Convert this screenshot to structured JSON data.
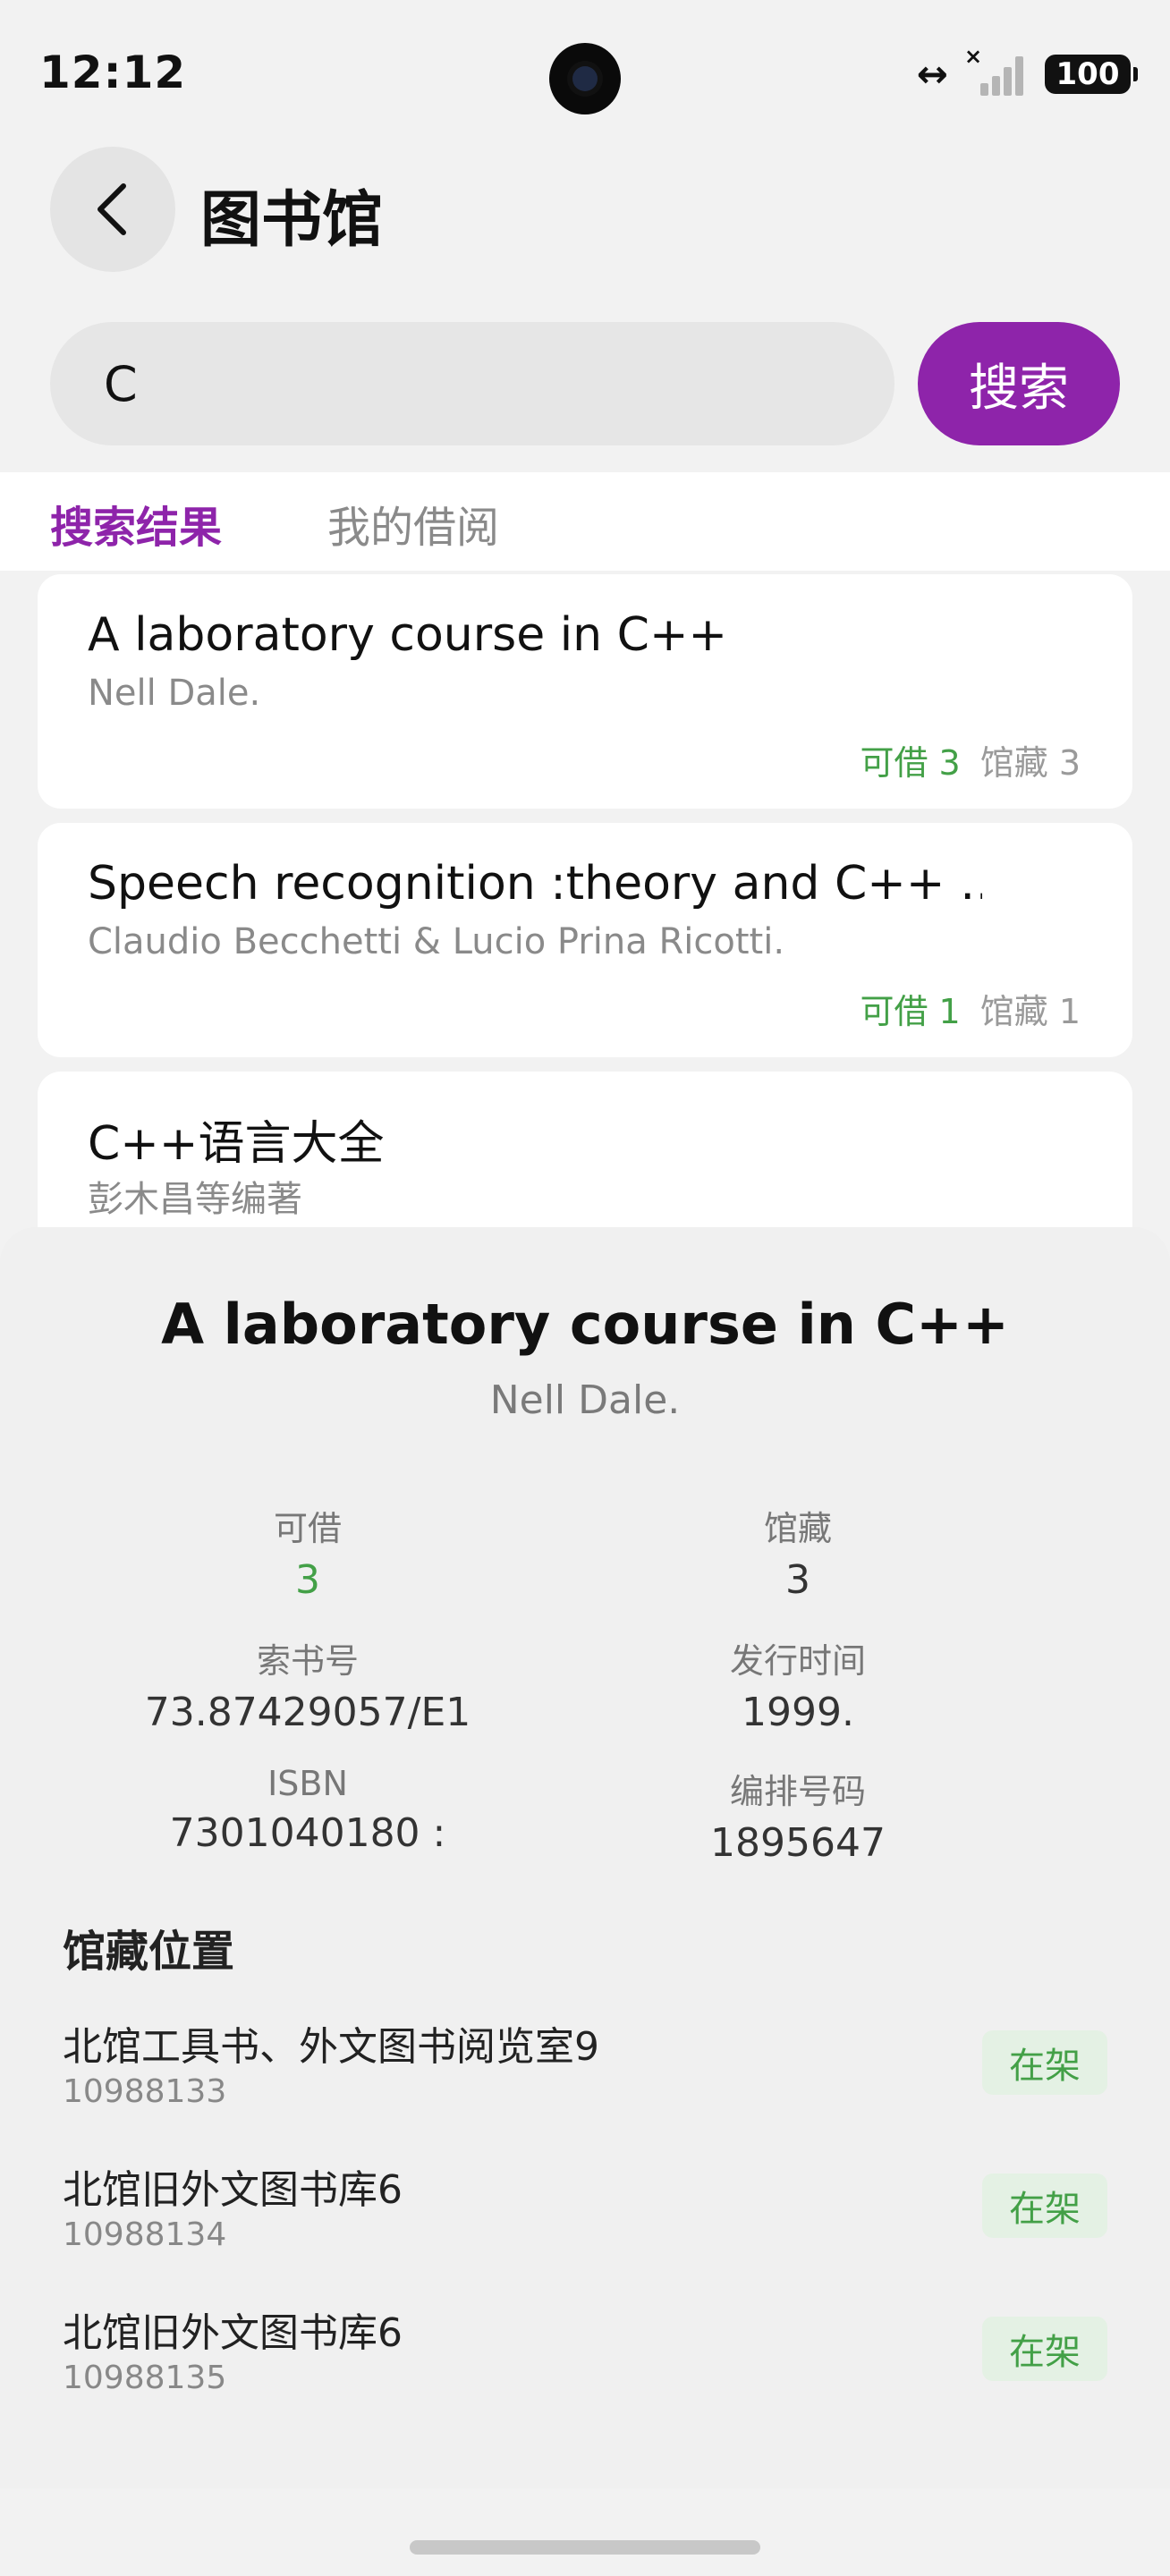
{
  "status_bar": {
    "time": "12:12",
    "battery": "100",
    "data_icon": "↔",
    "signal_x": "×"
  },
  "header": {
    "title": "图书馆",
    "back_icon": "chevron-left-icon"
  },
  "search": {
    "value": "C",
    "button_label": "搜索"
  },
  "tabs": [
    {
      "label": "搜索结果",
      "active": true
    },
    {
      "label": "我的借阅",
      "active": false
    }
  ],
  "results": [
    {
      "title": "A laboratory course in C++",
      "author": "Nell Dale.",
      "available_label": "可借 3",
      "holdings_label": "馆藏 3"
    },
    {
      "title": "Speech recognition  :theory and C++ …",
      "author": "Claudio Becchetti & Lucio Prina Ricotti.",
      "available_label": "可借 1",
      "holdings_label": "馆藏 1"
    },
    {
      "title": "C++语言大全",
      "author": "彭木昌等编著"
    }
  ],
  "detail": {
    "title": "A laboratory course in C++",
    "author": "Nell Dale.",
    "fields": {
      "available": {
        "label": "可借",
        "value": "3"
      },
      "holdings": {
        "label": "馆藏",
        "value": "3"
      },
      "call_number": {
        "label": "索书号",
        "value": "73.87429057/E1"
      },
      "publish_date": {
        "label": "发行时间",
        "value": "1999."
      },
      "isbn": {
        "label": "ISBN",
        "value": "7301040180 :"
      },
      "record_number": {
        "label": "编排号码",
        "value": "1895647"
      }
    },
    "locations_title": "馆藏位置",
    "locations": [
      {
        "name": "北馆工具书、外文图书阅览室9",
        "barcode": "10988133",
        "status": "在架"
      },
      {
        "name": "北馆旧外文图书库6",
        "barcode": "10988134",
        "status": "在架"
      },
      {
        "name": "北馆旧外文图书库6",
        "barcode": "10988135",
        "status": "在架"
      }
    ]
  },
  "colors": {
    "accent": "#8e24aa",
    "available": "#43a047",
    "badge_bg": "#e4f1e4"
  }
}
